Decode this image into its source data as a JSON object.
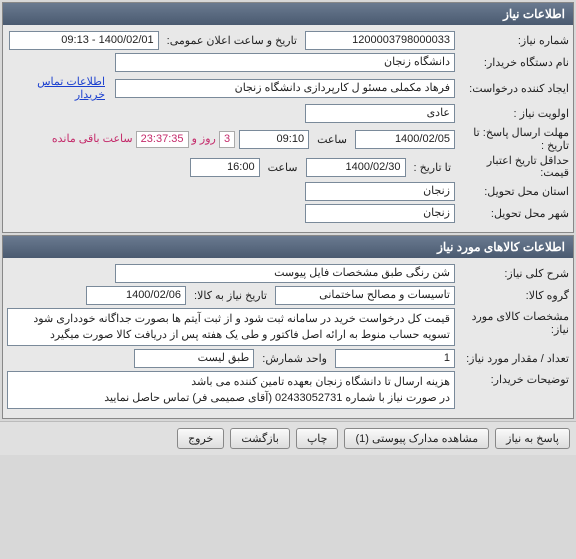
{
  "sections": {
    "info_title": "اطلاعات نیاز",
    "goods_title": "اطلاعات کالاهای مورد نیاز"
  },
  "info": {
    "req_no_label": "شماره نیاز:",
    "req_no": "1200003798000033",
    "pub_label": "تاریخ و ساعت اعلان عمومی:",
    "pub_val": "1400/02/01 - 09:13",
    "buyer_label": "نام دستگاه خریدار:",
    "buyer_val": "دانشگاه زنجان",
    "creator_label": "ایجاد کننده درخواست:",
    "creator_val": "فرهاد مکملی مسئو ل کارپردازی دانشگاه زنجان",
    "contact_link": "اطلاعات تماس خریدار",
    "priority_label": "اولویت نیاز :",
    "priority_val": "عادی",
    "deadline_label": "مهلت ارسال پاسخ:  تا تاریخ :",
    "deadline_date": "1400/02/05",
    "time_lbl": "ساعت",
    "deadline_time": "09:10",
    "days_val": "3",
    "days_suffix": "روز و",
    "countdown": "23:37:35",
    "remain_suffix": "ساعت باقی مانده",
    "validity_label": "حداقل تاریخ اعتبار قیمت:",
    "validity_date_lbl": "تا تاریخ :",
    "validity_date": "1400/02/30",
    "validity_time": "16:00",
    "province_label": "استان محل تحویل:",
    "province_val": "زنجان",
    "city_label": "شهر محل تحویل:",
    "city_val": "زنجان"
  },
  "goods": {
    "desc_label": "شرح کلی نیاز:",
    "desc_val": "شن رنگی طبق مشخصات فایل پیوست",
    "group_label": "گروه کالا:",
    "group_val": "تاسیسات و مصالح ساختمانی",
    "date_to_goods_label": "تاریخ نیاز به کالا:",
    "date_to_goods_val": "1400/02/06",
    "spec_label": "مشخصات کالای مورد نیاز:",
    "spec_val": "قیمت کل درخواست خرید در سامانه ثبت شود و از ثبت آیتم ها بصورت جداگانه خودداری شود\nتسویه حساب منوط به ارائه اصل فاکتور و طی یک هفته پس از دریافت کالا صورت میگیرد",
    "qty_label": "تعداد / مقدار مورد نیاز:",
    "qty_val": "1",
    "unit_label": "واحد شمارش:",
    "unit_val": "طبق لیست",
    "notes_label": "توضیحات خریدار:",
    "notes_val": "هزینه ارسال تا دانشگاه زنجان بعهده تامین کننده می باشد\nدر صورت نیاز با شماره 02433052731 (آقای صمیمی فر) تماس حاصل نمایید"
  },
  "buttons": {
    "reply": "پاسخ به نیاز",
    "attachments": "مشاهده مدارک پیوستی (1)",
    "print": "چاپ",
    "back": "بازگشت",
    "exit": "خروج"
  }
}
